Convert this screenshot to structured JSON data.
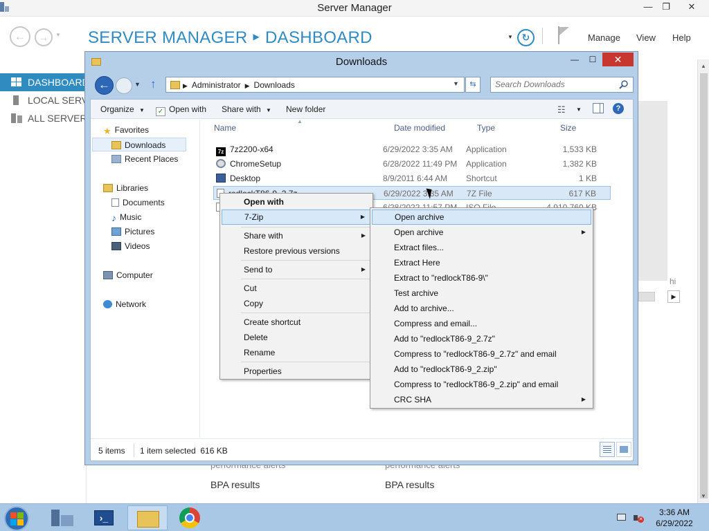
{
  "server_manager": {
    "window_title": "Server Manager",
    "breadcrumb": {
      "root": "SERVER MANAGER",
      "current": "DASHBOARD"
    },
    "menu": {
      "manage": "Manage",
      "view": "View",
      "help": "Help"
    },
    "sidebar": [
      {
        "label": "DASHBOARD",
        "active": true
      },
      {
        "label": "LOCAL SERVER",
        "active": false
      },
      {
        "label": "ALL SERVERS",
        "active": false
      }
    ],
    "behind_text": {
      "hidden_partial": "hi",
      "performance_alerts_1": "performance alerts",
      "performance_alerts_2": "performance alerts",
      "bpa_results_1": "BPA results",
      "bpa_results_2": "BPA results"
    }
  },
  "explorer": {
    "title": "Downloads",
    "address": {
      "segments": [
        "Administrator",
        "Downloads"
      ]
    },
    "search_placeholder": "Search Downloads",
    "commands": {
      "organize": "Organize",
      "open_with": "Open with",
      "share_with": "Share with",
      "new_folder": "New folder"
    },
    "nav": {
      "favorites": "Favorites",
      "downloads": "Downloads",
      "recent_places": "Recent Places",
      "libraries": "Libraries",
      "documents": "Documents",
      "music": "Music",
      "pictures": "Pictures",
      "videos": "Videos",
      "computer": "Computer",
      "network": "Network"
    },
    "columns": {
      "name": "Name",
      "date": "Date modified",
      "type": "Type",
      "size": "Size"
    },
    "files": [
      {
        "name": "7z2200-x64",
        "date": "6/29/2022 3:35 AM",
        "type": "Application",
        "size": "1,533 KB",
        "icon": "7zip-installer-icon"
      },
      {
        "name": "ChromeSetup",
        "date": "6/28/2022 11:49 PM",
        "type": "Application",
        "size": "1,382 KB",
        "icon": "chrome-setup-icon"
      },
      {
        "name": "Desktop",
        "date": "8/9/2011 6:44 AM",
        "type": "Shortcut",
        "size": "1 KB",
        "icon": "shortcut-icon"
      },
      {
        "name": "redlockT86-9_2.7z",
        "date": "6/29/2022 3:35 AM",
        "type": "7Z File",
        "size": "617 KB",
        "icon": "7z-file-icon"
      },
      {
        "name": "",
        "date": "6/28/2022 11:57 PM",
        "type": "ISO File",
        "size": "4,910,760 KB",
        "icon": "iso-file-icon"
      }
    ],
    "status": {
      "items": "5 items",
      "selected": "1 item selected  616 KB"
    }
  },
  "context_menu": {
    "items": {
      "open_with": "Open with",
      "seven_zip": "7-Zip",
      "share_with": "Share with",
      "restore": "Restore previous versions",
      "send_to": "Send to",
      "cut": "Cut",
      "copy": "Copy",
      "create_shortcut": "Create shortcut",
      "delete": "Delete",
      "rename": "Rename",
      "properties": "Properties"
    }
  },
  "submenu_7zip": [
    "Open archive",
    "Open archive",
    "Extract files...",
    "Extract Here",
    "Extract to \"redlockT86-9\\\"",
    "Test archive",
    "Add to archive...",
    "Compress and email...",
    "Add to \"redlockT86-9_2.7z\"",
    "Compress to \"redlockT86-9_2.7z\" and email",
    "Add to \"redlockT86-9_2.zip\"",
    "Compress to \"redlockT86-9_2.zip\" and email",
    "CRC SHA"
  ],
  "taskbar": {
    "clock_time": "3:36 AM",
    "clock_date": "6/29/2022"
  },
  "colors": {
    "accent": "#2f8bc0",
    "explorer_frame": "#b5cfe8",
    "close_red": "#c7372f",
    "menu_highlight": "#d7e8f9",
    "taskbar": "#a9c8e6"
  }
}
